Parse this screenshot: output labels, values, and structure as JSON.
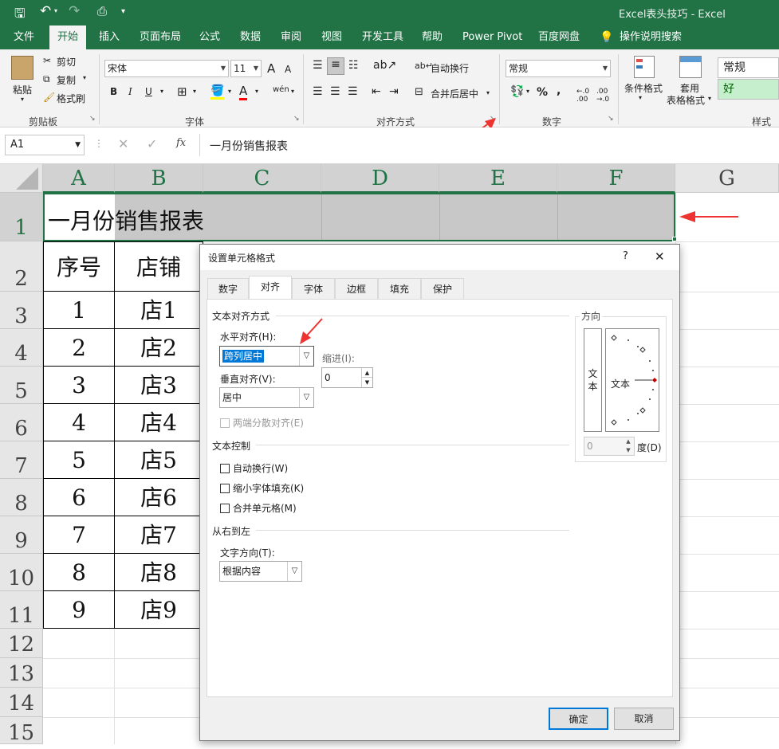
{
  "window": {
    "title": "Excel表头技巧  -  Excel"
  },
  "ribbon_tabs": [
    "文件",
    "开始",
    "插入",
    "页面布局",
    "公式",
    "数据",
    "审阅",
    "视图",
    "开发工具",
    "帮助",
    "Power Pivot",
    "百度网盘",
    "操作说明搜索"
  ],
  "active_tab": "开始",
  "ribbon": {
    "clipboard": {
      "paste": "粘贴",
      "cut": "剪切",
      "copy": "复制",
      "painter": "格式刷",
      "group": "剪贴板"
    },
    "font": {
      "name": "宋体",
      "size": "11",
      "bold": "B",
      "italic": "I",
      "underline": "U",
      "group": "字体",
      "grow": "A",
      "shrink": "A",
      "font_color": "A",
      "phonetic": "wén"
    },
    "alignment": {
      "wrap": "自动换行",
      "merge": "合并后居中",
      "group": "对齐方式"
    },
    "number": {
      "format": "常规",
      "percent": "%",
      "comma": ",",
      "group": "数字"
    },
    "styles": {
      "cond": "条件格式",
      "table1": "套用",
      "table2": "表格格式",
      "normal": "常规",
      "good": "好",
      "group": "样式"
    }
  },
  "namebox": "A1",
  "formula": "一月份销售报表",
  "fx": "fx",
  "columns": [
    "A",
    "B",
    "C",
    "D",
    "E",
    "F",
    "G"
  ],
  "rows": [
    "1",
    "2",
    "3",
    "4",
    "5",
    "6",
    "7",
    "8",
    "9",
    "10",
    "11",
    "12",
    "13",
    "14",
    "15"
  ],
  "sheet": {
    "title": "一月份销售报表",
    "header": [
      "序号",
      "店铺"
    ],
    "data": [
      [
        "1",
        "店1"
      ],
      [
        "2",
        "店2"
      ],
      [
        "3",
        "店3"
      ],
      [
        "4",
        "店4"
      ],
      [
        "5",
        "店5"
      ],
      [
        "6",
        "店6"
      ],
      [
        "7",
        "店7"
      ],
      [
        "8",
        "店8"
      ],
      [
        "9",
        "店9"
      ]
    ]
  },
  "dialog": {
    "title": "设置单元格格式",
    "help": "?",
    "close": "✕",
    "tabs": [
      "数字",
      "对齐",
      "字体",
      "边框",
      "填充",
      "保护"
    ],
    "active_tab": "对齐",
    "text_align_section": "文本对齐方式",
    "horizontal_label": "水平对齐(H):",
    "horizontal_value": "跨列居中",
    "indent_label": "缩进(I):",
    "indent_value": "0",
    "vertical_label": "垂直对齐(V):",
    "vertical_value": "居中",
    "distributed": "两端分散对齐(E)",
    "text_control_section": "文本控制",
    "wrap": "自动换行(W)",
    "shrink": "缩小字体填充(K)",
    "merge": "合并单元格(M)",
    "rtl_section": "从右到左",
    "text_dir_label": "文字方向(T):",
    "text_dir_value": "根据内容",
    "orientation_label": "方向",
    "orientation_vertical_text": "文\n本",
    "orientation_text": "文本",
    "degree_value": "0",
    "degree_label": "度(D)",
    "ok": "确定",
    "cancel": "取消"
  }
}
